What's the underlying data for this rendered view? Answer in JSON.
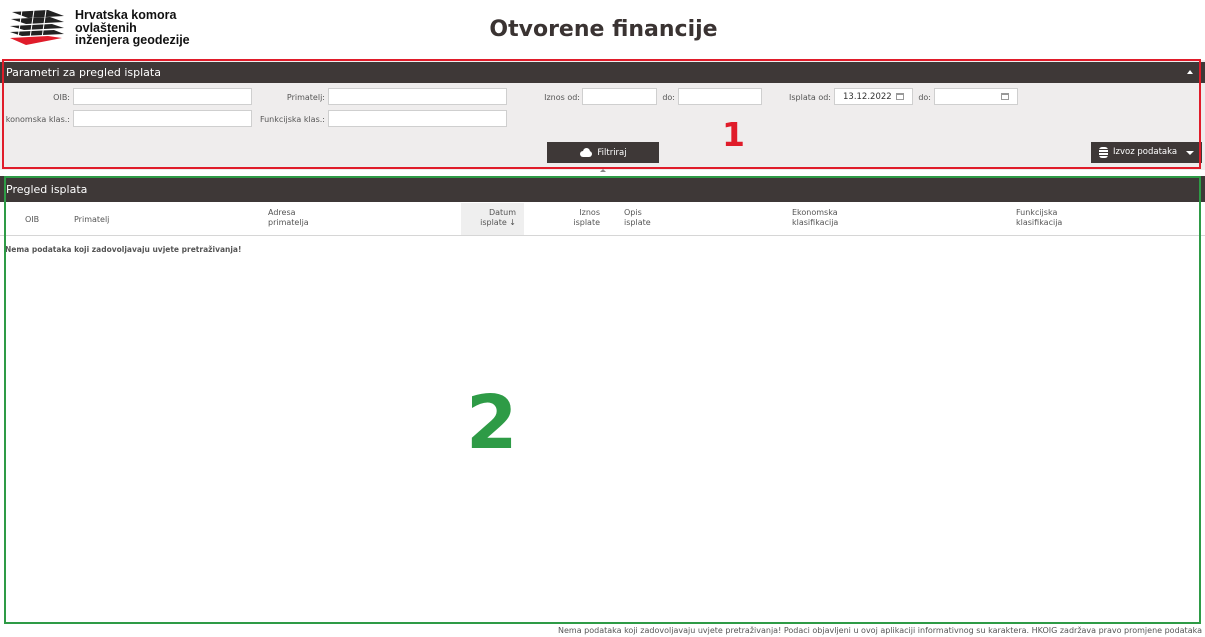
{
  "header": {
    "org_line1": "Hrvatska komora",
    "org_line2": "ovlaštenih",
    "org_line3": "inženjera geodezije",
    "page_title": "Otvorene financije"
  },
  "filters": {
    "title": "Parametri za pregled isplata",
    "oib_label": "OIB:",
    "oib_value": "",
    "primatelj_label": "Primatelj:",
    "primatelj_value": "",
    "iznos_od_label": "Iznos od:",
    "iznos_od_value": "",
    "iznos_do_label": "do:",
    "iznos_do_value": "",
    "isplata_od_label": "Isplata od:",
    "isplata_od_value": "13.12.2022",
    "isplata_do_label": "do:",
    "isplata_do_value": "",
    "ekonomska_label": "konomska klas.:",
    "ekonomska_value": "",
    "funkcijska_label": "Funkcijska klas.:",
    "funkcijska_value": "",
    "filter_button": "Filtriraj",
    "export_button": "Izvoz podataka"
  },
  "annotations": {
    "region1": "1",
    "region2": "2",
    "color1": "#e01c2a",
    "color2": "#2e9b46"
  },
  "table": {
    "title": "Pregled isplata",
    "columns": [
      {
        "line1": "OIB",
        "line2": ""
      },
      {
        "line1": "Primatelj",
        "line2": ""
      },
      {
        "line1": "Adresa",
        "line2": "primatelja"
      },
      {
        "line1": "Datum",
        "line2": "isplate ↓"
      },
      {
        "line1": "Iznos",
        "line2": "isplate"
      },
      {
        "line1": "Opis",
        "line2": "isplate"
      },
      {
        "line1": "Ekonomska",
        "line2": "klasifikacija"
      },
      {
        "line1": "Funkcijska",
        "line2": "klasifikacija"
      }
    ],
    "empty_message": "Nema podataka koji zadovoljavaju uvjete pretraživanja!"
  },
  "footer": {
    "text": "Nema podataka koji zadovoljavaju uvjete pretraživanja! Podaci objavljeni u ovoj aplikaciji informativnog su karaktera. HKOIG zadržava pravo promjene podataka"
  },
  "colors": {
    "dark_bar": "#3e3837",
    "panel_bg": "#efeded"
  }
}
